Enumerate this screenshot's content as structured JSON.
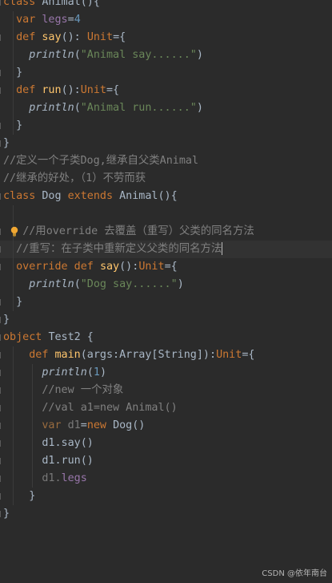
{
  "editor": {
    "lines": [
      {
        "tokens": [
          {
            "c": "kw",
            "t": "class "
          },
          {
            "c": "pl",
            "t": "Animal(){"
          }
        ]
      },
      {
        "tokens": [
          {
            "c": "pl",
            "t": "  "
          },
          {
            "c": "kw",
            "t": "var "
          },
          {
            "c": "field",
            "t": "legs"
          },
          {
            "c": "pl",
            "t": "="
          },
          {
            "c": "num",
            "t": "4"
          }
        ]
      },
      {
        "tokens": [
          {
            "c": "pl",
            "t": "  "
          },
          {
            "c": "kw",
            "t": "def "
          },
          {
            "c": "fn",
            "t": "say"
          },
          {
            "c": "pl",
            "t": "(): "
          },
          {
            "c": "kw",
            "t": "Unit"
          },
          {
            "c": "pl",
            "t": "={"
          }
        ]
      },
      {
        "tokens": [
          {
            "c": "pl",
            "t": "    "
          },
          {
            "c": "it",
            "t": "println"
          },
          {
            "c": "pl",
            "t": "("
          },
          {
            "c": "str",
            "t": "\"Animal say......\""
          },
          {
            "c": "pl",
            "t": ")"
          }
        ]
      },
      {
        "tokens": [
          {
            "c": "pl",
            "t": "  }"
          }
        ]
      },
      {
        "tokens": [
          {
            "c": "pl",
            "t": "  "
          },
          {
            "c": "kw",
            "t": "def "
          },
          {
            "c": "fn",
            "t": "run"
          },
          {
            "c": "pl",
            "t": "():"
          },
          {
            "c": "kw",
            "t": "Unit"
          },
          {
            "c": "pl",
            "t": "={"
          }
        ]
      },
      {
        "tokens": [
          {
            "c": "pl",
            "t": "    "
          },
          {
            "c": "it",
            "t": "println"
          },
          {
            "c": "pl",
            "t": "("
          },
          {
            "c": "str",
            "t": "\"Animal run......\""
          },
          {
            "c": "pl",
            "t": ")"
          }
        ]
      },
      {
        "tokens": [
          {
            "c": "pl",
            "t": "  }"
          }
        ]
      },
      {
        "tokens": [
          {
            "c": "pl",
            "t": "}"
          }
        ]
      },
      {
        "tokens": [
          {
            "c": "cm",
            "t": "//定义一个子类Dog,继承自父类Animal"
          }
        ]
      },
      {
        "tokens": [
          {
            "c": "cm",
            "t": "//继承的好处，（1）不劳而获"
          }
        ]
      },
      {
        "tokens": [
          {
            "c": "kw",
            "t": "class "
          },
          {
            "c": "pl",
            "t": "Dog "
          },
          {
            "c": "kw",
            "t": "extends "
          },
          {
            "c": "pl",
            "t": "Animal(){"
          }
        ]
      },
      {
        "tokens": []
      },
      {
        "tokens": [
          {
            "c": "pl",
            "t": "   "
          },
          {
            "c": "cm",
            "t": "//用override 去覆盖（重写）父类的同名方法"
          }
        ],
        "bulb": true
      },
      {
        "tokens": [
          {
            "c": "pl",
            "t": "  "
          },
          {
            "c": "cm",
            "t": "//重写：在子类中重新定义父类的同名方法"
          }
        ],
        "current": true,
        "caret": true
      },
      {
        "tokens": [
          {
            "c": "pl",
            "t": "  "
          },
          {
            "c": "kw",
            "t": "override def "
          },
          {
            "c": "fn",
            "t": "say"
          },
          {
            "c": "pl",
            "t": "():"
          },
          {
            "c": "kw",
            "t": "Unit"
          },
          {
            "c": "pl",
            "t": "={"
          }
        ]
      },
      {
        "tokens": [
          {
            "c": "pl",
            "t": "    "
          },
          {
            "c": "it",
            "t": "println"
          },
          {
            "c": "pl",
            "t": "("
          },
          {
            "c": "str",
            "t": "\"Dog say......\""
          },
          {
            "c": "pl",
            "t": ")"
          }
        ]
      },
      {
        "tokens": [
          {
            "c": "pl",
            "t": "  }"
          }
        ]
      },
      {
        "tokens": [
          {
            "c": "pl",
            "t": "}"
          }
        ]
      },
      {
        "tokens": [
          {
            "c": "kw",
            "t": "object "
          },
          {
            "c": "pl",
            "t": "Test2 {"
          }
        ]
      },
      {
        "tokens": [
          {
            "c": "pl",
            "t": "    "
          },
          {
            "c": "kw",
            "t": "def "
          },
          {
            "c": "fn",
            "t": "main"
          },
          {
            "c": "pl",
            "t": "(args:Array[String]):"
          },
          {
            "c": "kw",
            "t": "Unit"
          },
          {
            "c": "pl",
            "t": "={"
          }
        ]
      },
      {
        "tokens": [
          {
            "c": "pl",
            "t": "      "
          },
          {
            "c": "it",
            "t": "println"
          },
          {
            "c": "pl",
            "t": "("
          },
          {
            "c": "num",
            "t": "1"
          },
          {
            "c": "pl",
            "t": ")"
          }
        ]
      },
      {
        "tokens": [
          {
            "c": "pl",
            "t": "      "
          },
          {
            "c": "cm",
            "t": "//new 一个对象"
          }
        ]
      },
      {
        "tokens": [
          {
            "c": "pl",
            "t": "      "
          },
          {
            "c": "cm",
            "t": "//val a1=new Animal()"
          }
        ]
      },
      {
        "tokens": [
          {
            "c": "pl",
            "t": "      "
          },
          {
            "c": "kwdim",
            "t": "var "
          },
          {
            "c": "dim",
            "t": "d1"
          },
          {
            "c": "pl",
            "t": "="
          },
          {
            "c": "kw",
            "t": "new "
          },
          {
            "c": "pl",
            "t": "Dog()"
          }
        ]
      },
      {
        "tokens": [
          {
            "c": "pl",
            "t": "      d1.say()"
          }
        ]
      },
      {
        "tokens": [
          {
            "c": "pl",
            "t": "      d1.run()"
          }
        ]
      },
      {
        "tokens": [
          {
            "c": "pl",
            "t": "      d1."
          },
          {
            "c": "field",
            "t": "legs"
          }
        ],
        "dimline": true
      },
      {
        "tokens": [
          {
            "c": "pl",
            "t": "    }"
          }
        ]
      },
      {
        "tokens": [
          {
            "c": "pl",
            "t": "}"
          }
        ]
      }
    ]
  },
  "watermark": "CSDN @依年南台"
}
